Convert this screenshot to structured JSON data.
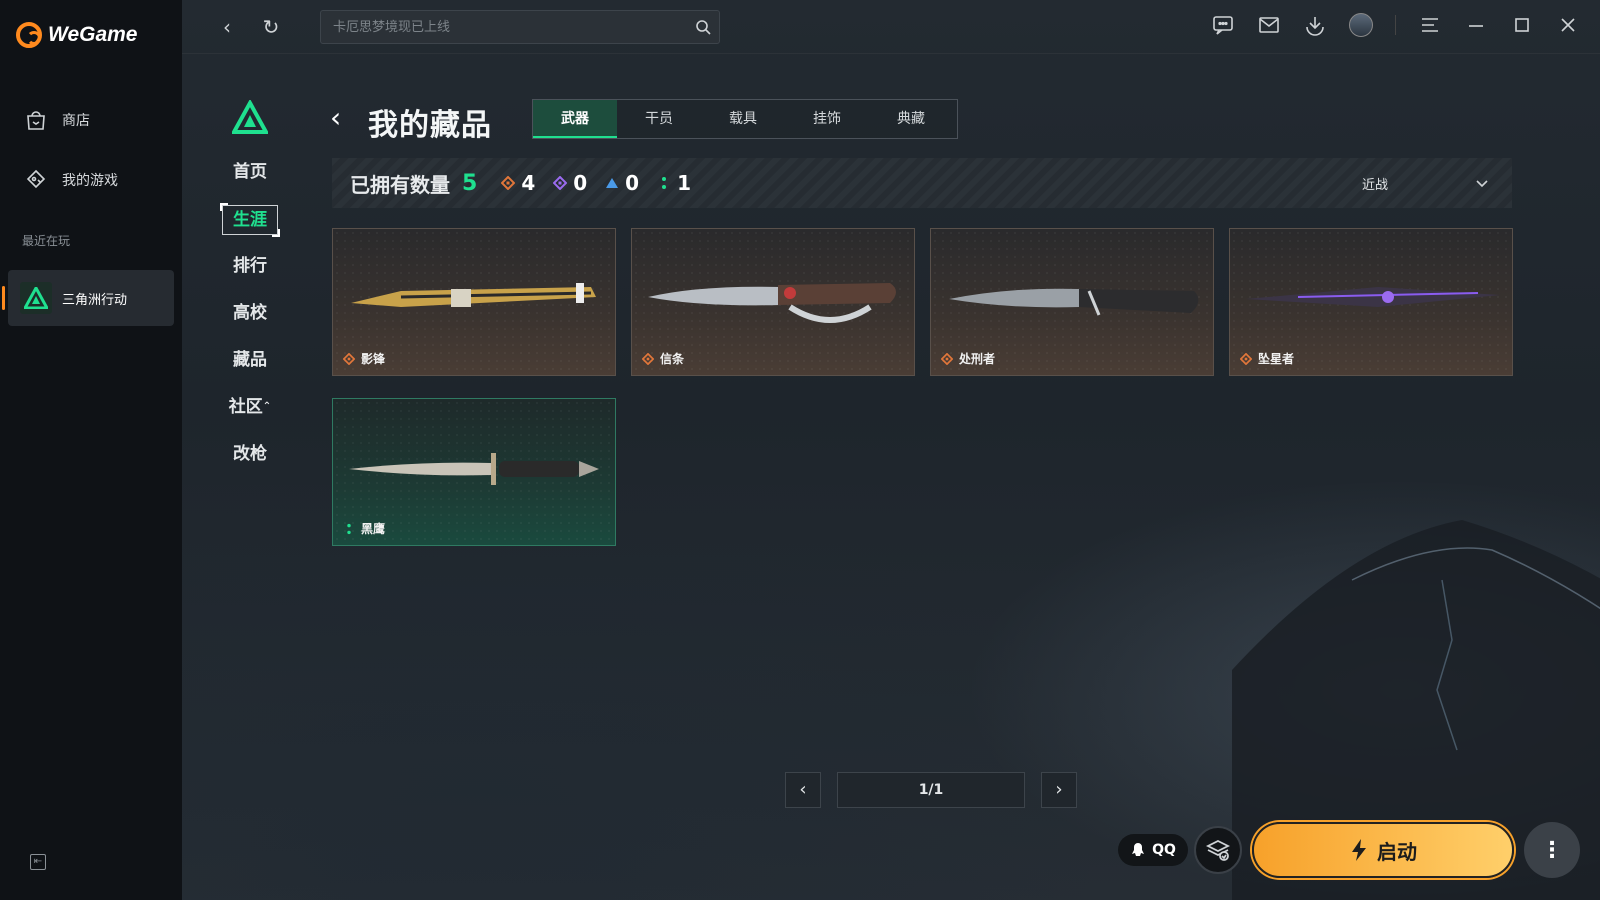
{
  "app": {
    "name": "WeGame",
    "accent_color": "#ff8a1e",
    "highlight_color": "#1fe08f"
  },
  "sidebar": {
    "items": [
      {
        "label": "商店",
        "icon": "shop-bag-icon"
      },
      {
        "label": "我的游戏",
        "icon": "game-controller-icon"
      }
    ],
    "recent_title": "最近在玩",
    "recent_game": {
      "label": "三角洲行动",
      "icon": "delta-force-logo-icon"
    },
    "collapse_icon": "collapse-sidebar-icon"
  },
  "topbar": {
    "search": {
      "placeholder": "卡厄思梦境现已上线",
      "value": ""
    },
    "icons": [
      "chat-icon",
      "mail-icon",
      "download-icon",
      "avatar",
      "menu-icon",
      "minimize-icon",
      "maximize-icon",
      "close-icon"
    ]
  },
  "game_nav": {
    "items": [
      "首页",
      "生涯",
      "排行",
      "高校",
      "藏品",
      "社区",
      "改枪"
    ],
    "active": "生涯",
    "community_caret": "⌃"
  },
  "collection": {
    "title": "我的藏品",
    "tabs": [
      "武器",
      "干员",
      "载具",
      "挂饰",
      "典藏"
    ],
    "active_tab": "武器",
    "owned_label": "已拥有数量",
    "owned_count": "5",
    "rarity_counts": [
      {
        "icon": "orange-diamond-icon",
        "color": "#e0763a",
        "count": "4"
      },
      {
        "icon": "purple-diamond-icon",
        "color": "#9b6bf0",
        "count": "0"
      },
      {
        "icon": "blue-triangle-icon",
        "color": "#4a9ae8",
        "count": "0"
      },
      {
        "icon": "green-dots-icon",
        "color": "#1fe08f",
        "count": "1"
      }
    ],
    "filter": {
      "selected": "近战"
    },
    "items": [
      {
        "name": "影锋",
        "rarity_color": "#e0763a",
        "rarity": "orange"
      },
      {
        "name": "信条",
        "rarity_color": "#e0763a",
        "rarity": "orange"
      },
      {
        "name": "处刑者",
        "rarity_color": "#e0763a",
        "rarity": "orange"
      },
      {
        "name": "坠星者",
        "rarity_color": "#e0763a",
        "rarity": "orange"
      },
      {
        "name": "黑鹰",
        "rarity_color": "#1fe08f",
        "rarity": "green"
      }
    ]
  },
  "pagination": {
    "label": "1/1"
  },
  "bottom_bar": {
    "qq_label": "QQ",
    "launch_label": "启动"
  }
}
